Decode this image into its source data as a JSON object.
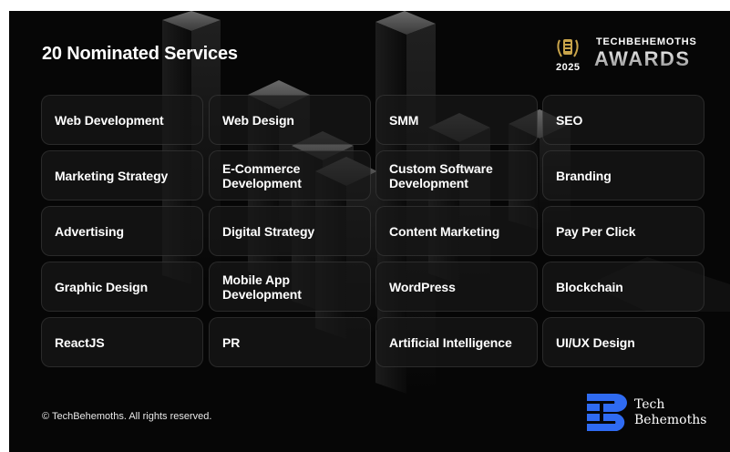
{
  "heading": "20 Nominated Services",
  "award": {
    "brand": "TECHBEHEMOTHS",
    "title": "AWARDS",
    "year": "2025",
    "accent": "#c9a44a"
  },
  "services": [
    "Web Development",
    "Web Design",
    "SMM",
    "SEO",
    "Marketing Strategy",
    "E-Commerce Development",
    "Custom Software Development",
    "Branding",
    "Advertising",
    "Digital Strategy",
    "Content Marketing",
    "Pay Per Click",
    "Graphic Design",
    "Mobile App Development",
    "WordPress",
    "Blockchain",
    "ReactJS",
    "PR",
    "Artificial Intelligence",
    "UI/UX Design"
  ],
  "footer": {
    "copyright": "© TechBehemoths. All rights reserved.",
    "logo_line1": "Tech",
    "logo_line2": "Behemoths",
    "logo_color": "#2f6bf2"
  }
}
